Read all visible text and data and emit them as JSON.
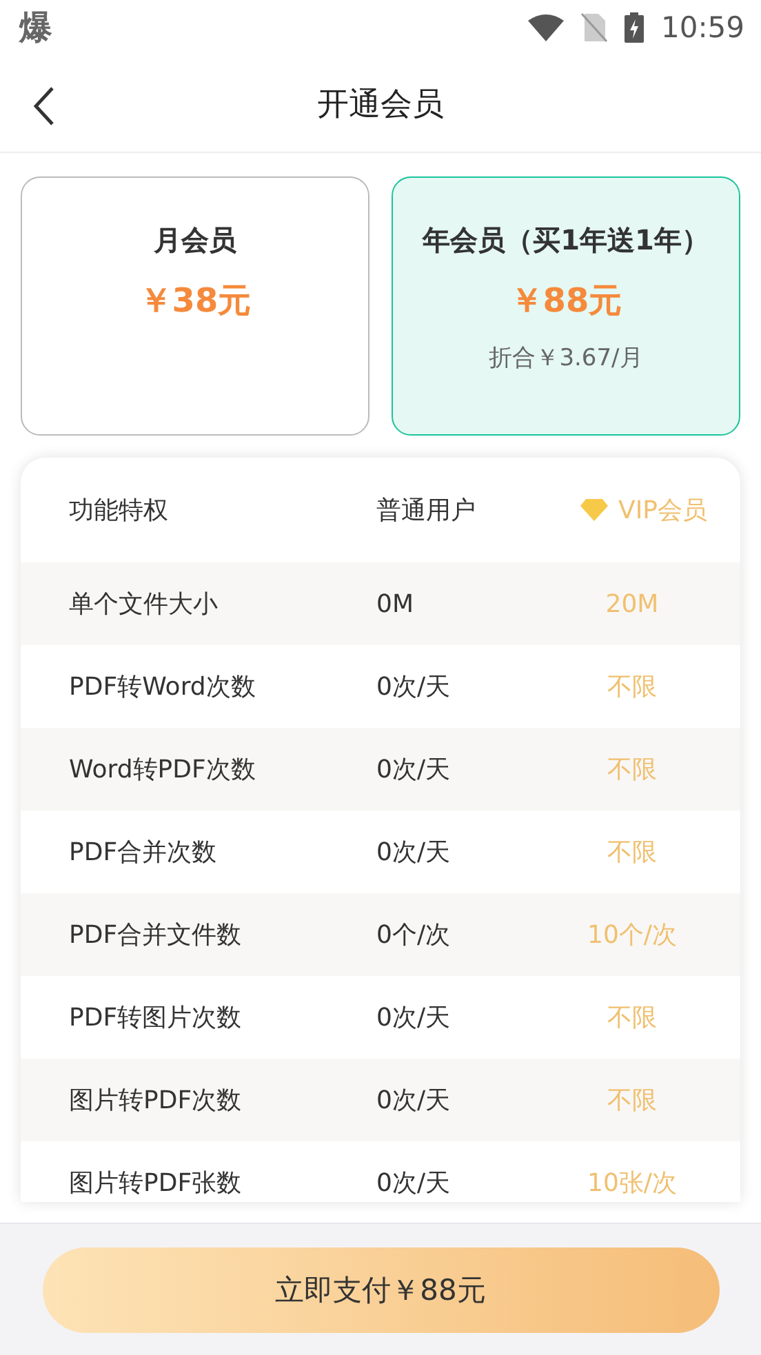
{
  "status_bar": {
    "app_glyph": "爆",
    "time": "10:59"
  },
  "header": {
    "title": "开通会员"
  },
  "plans": [
    {
      "name": "月会员",
      "price": "￥38元",
      "selected": false
    },
    {
      "name": "年会员（买1年送1年）",
      "price": "￥88元",
      "note": "折合￥3.67/月",
      "selected": true
    }
  ],
  "table": {
    "columns": [
      "功能特权",
      "普通用户",
      "VIP会员"
    ],
    "rows": [
      [
        "单个文件大小",
        "0M",
        "20M"
      ],
      [
        "PDF转Word次数",
        "0次/天",
        "不限"
      ],
      [
        "Word转PDF次数",
        "0次/天",
        "不限"
      ],
      [
        "PDF合并次数",
        "0次/天",
        "不限"
      ],
      [
        "PDF合并文件数",
        "0个/次",
        "10个/次"
      ],
      [
        "PDF转图片次数",
        "0次/天",
        "不限"
      ],
      [
        "图片转PDF次数",
        "0次/天",
        "不限"
      ],
      [
        "图片转PDF张数",
        "0次/天",
        "10张/次"
      ]
    ]
  },
  "pay_button": "立即支付￥88元"
}
